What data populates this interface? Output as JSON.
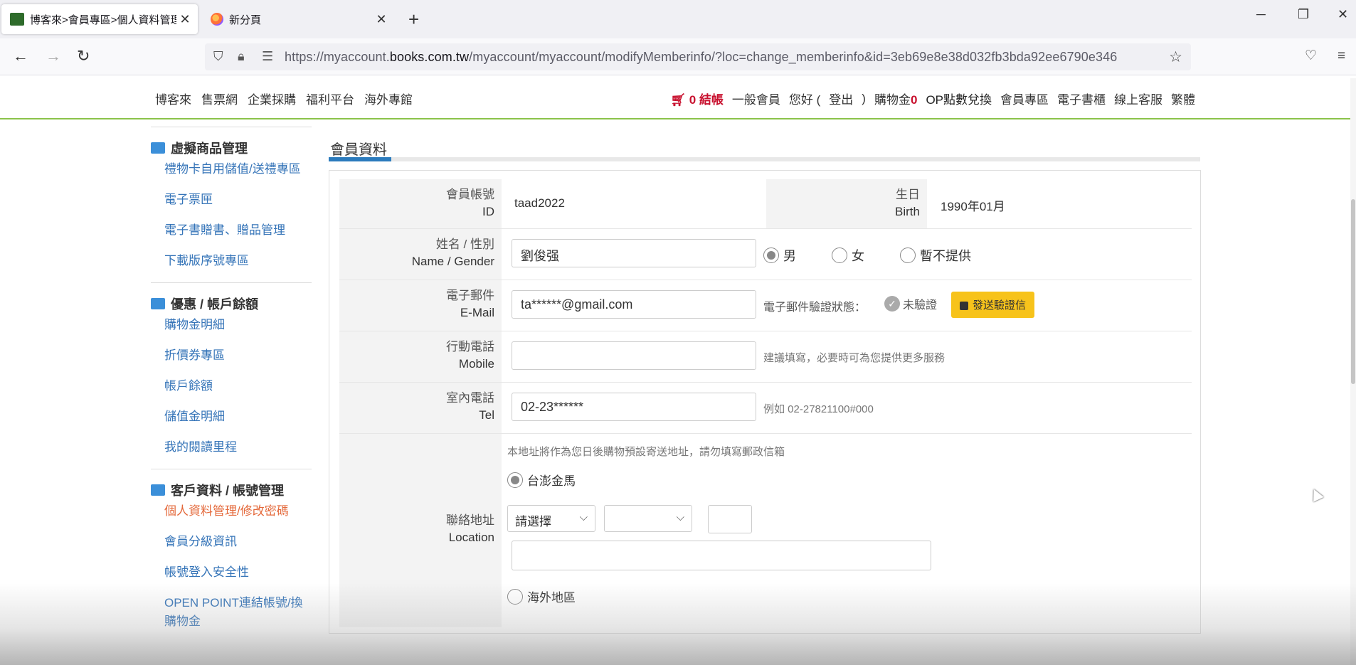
{
  "browser": {
    "tabs": [
      {
        "title": "博客來>會員專區>個人資料管理",
        "close": "✕",
        "active": true
      },
      {
        "title": "新分頁",
        "close": "✕",
        "active": false
      }
    ],
    "new_tab": "+",
    "window_controls": {
      "minimize": "─",
      "restore": "❐",
      "close": "✕"
    },
    "nav": {
      "back": "←",
      "forward": "→",
      "reload": "↻"
    },
    "url_prefix": "https://myaccount.",
    "url_host": "books.com.tw",
    "url_path": "/myaccount/myaccount/modifyMemberinfo/?loc=change_memberinfo&id=3eb69e8e38d032fb3bda92ee6790e346",
    "icons": [
      "shield-icon",
      "lock-icon",
      "permissions-icon",
      "bookmark-star-icon",
      "pocket-icon",
      "menu-icon"
    ]
  },
  "site_header": {
    "left_links": [
      "博客來",
      "售票網",
      "企業採購",
      "福利平台",
      "海外專館"
    ],
    "cart_count": "0",
    "cart_label": "結帳",
    "member_level": "一般會員",
    "greeting": "您好 (",
    "logout": "登出",
    "greeting_close": ")",
    "points_label": "購物金",
    "points_value": "0",
    "right_links": [
      "OP點數兌換",
      "會員專區",
      "電子書櫃",
      "線上客服",
      "繁體"
    ]
  },
  "sidebar": {
    "section1": {
      "title": "虛擬商品管理",
      "icon": "cards-icon",
      "items": [
        "禮物卡自用儲值/送禮專區",
        "電子票匣",
        "電子書贈書、贈品管理",
        "下載版序號專區"
      ]
    },
    "section2": {
      "title": "優惠 / 帳戶餘額",
      "icon": "wallet-icon",
      "items": [
        "購物金明細",
        "折價券專區",
        "帳戶餘額",
        "儲值金明細",
        "我的閱讀里程"
      ]
    },
    "section3": {
      "title": "客戶資料 / 帳號管理",
      "icon": "user-settings-icon",
      "items": [
        "個人資料管理/修改密碼",
        "會員分級資訊",
        "帳號登入安全性",
        "OPEN POINT連結帳號/換購物金"
      ],
      "current_index": 0
    }
  },
  "main": {
    "title": "會員資料",
    "fields": {
      "account": {
        "label_zh": "會員帳號",
        "label_en": "ID",
        "value": "taad2022"
      },
      "birth": {
        "label_zh": "生日",
        "label_en": "Birth",
        "value": "1990年01月"
      },
      "name": {
        "label_zh": "姓名 / 性別",
        "label_en": "Name / Gender",
        "value": "劉俊强"
      },
      "gender_options": [
        {
          "label": "男",
          "selected": true
        },
        {
          "label": "女",
          "selected": false
        },
        {
          "label": "暫不提供",
          "selected": false
        }
      ],
      "email": {
        "label_zh": "電子郵件",
        "label_en": "E-Mail",
        "value": "ta******@gmail.com",
        "status_label": "電子郵件驗證狀態：",
        "status_value": "未驗證",
        "verify_button": "發送驗證信"
      },
      "mobile": {
        "label_zh": "行動電話",
        "label_en": "Mobile",
        "value": "",
        "hint": "建議填寫，必要時可為您提供更多服務"
      },
      "tel": {
        "label_zh": "室內電話",
        "label_en": "Tel",
        "value": "02-23******",
        "hint": "例如 02-27821100#000"
      },
      "address": {
        "label_zh": "聯絡地址",
        "label_en": "Location",
        "notice": "本地址將作為您日後購物預設寄送地址，請勿填寫郵政信箱",
        "domestic": {
          "label": "台澎金馬",
          "selected": true
        },
        "city_select": "請選擇",
        "district_select": "",
        "zip": "",
        "street": "",
        "overseas": {
          "label": "海外地區",
          "selected": false
        }
      }
    }
  }
}
